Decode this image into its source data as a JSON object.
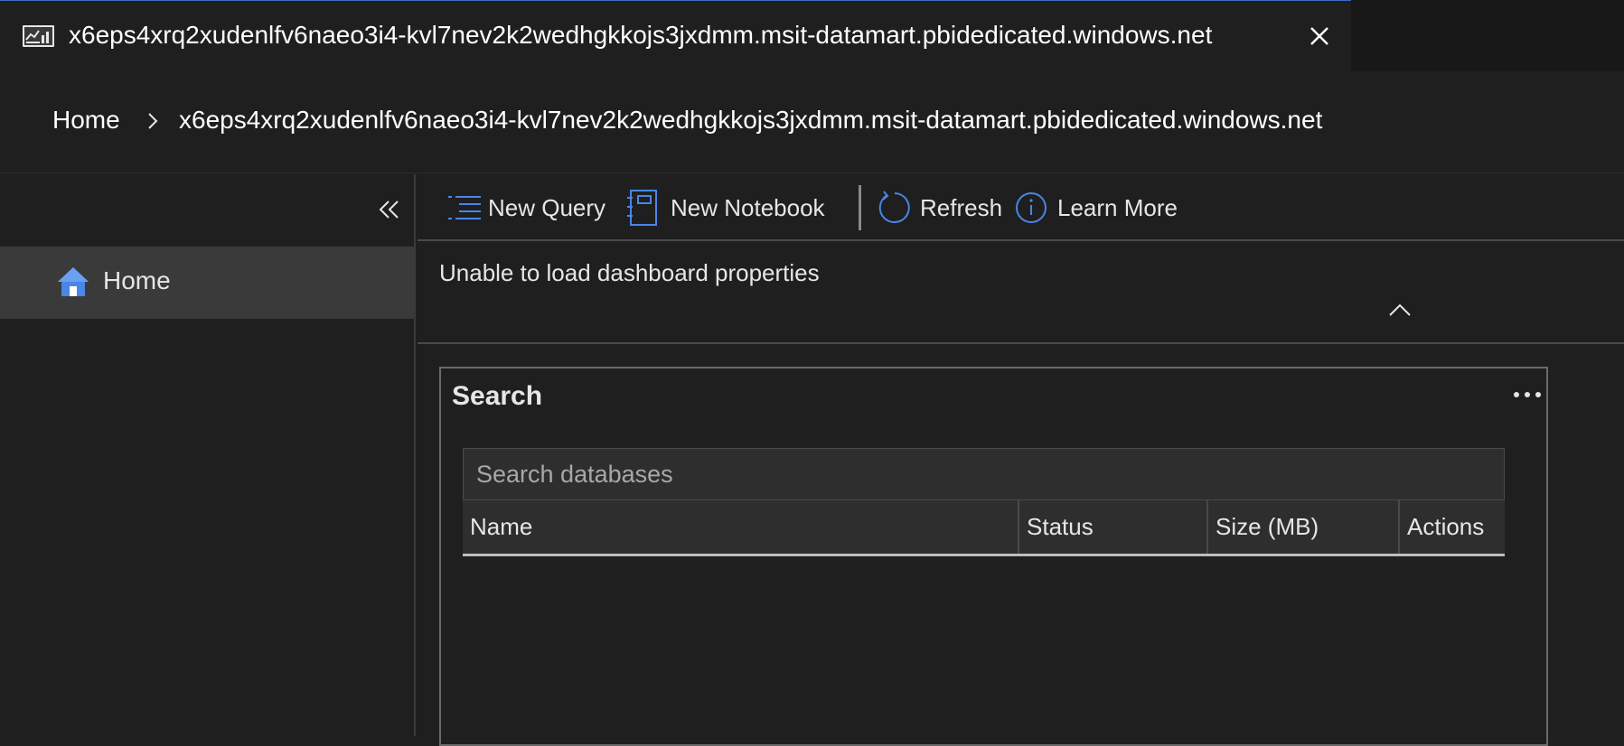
{
  "tab": {
    "title": "x6eps4xrq2xudenlfv6naeo3i4-kvl7nev2k2wedhgkkojs3jxdmm.msit-datamart.pbidedicated.windows.net",
    "icon": "dashboard-chart-icon",
    "close_icon": "close-icon"
  },
  "breadcrumb": {
    "home": "Home",
    "separator_icon": "chevron-right-icon",
    "current": "x6eps4xrq2xudenlfv6naeo3i4-kvl7nev2k2wedhgkkojs3jxdmm.msit-datamart.pbidedicated.windows.net"
  },
  "sidebar": {
    "collapse_icon": "double-chevron-left-icon",
    "items": [
      {
        "label": "Home",
        "icon": "home-icon",
        "selected": true
      }
    ]
  },
  "toolbar": {
    "new_query": "New Query",
    "new_notebook": "New Notebook",
    "refresh": "Refresh",
    "learn_more": "Learn More"
  },
  "notice": {
    "message": "Unable to load dashboard properties",
    "toggle_icon": "chevron-up-icon"
  },
  "search_card": {
    "title": "Search",
    "more_icon": "ellipsis-icon",
    "placeholder": "Search databases",
    "value": "",
    "columns": [
      "Name",
      "Status",
      "Size (MB)",
      "Actions"
    ]
  },
  "colors": {
    "accent": "#3b78d8",
    "background": "#1f1f1f",
    "selected_nav": "#3a3a3a"
  }
}
